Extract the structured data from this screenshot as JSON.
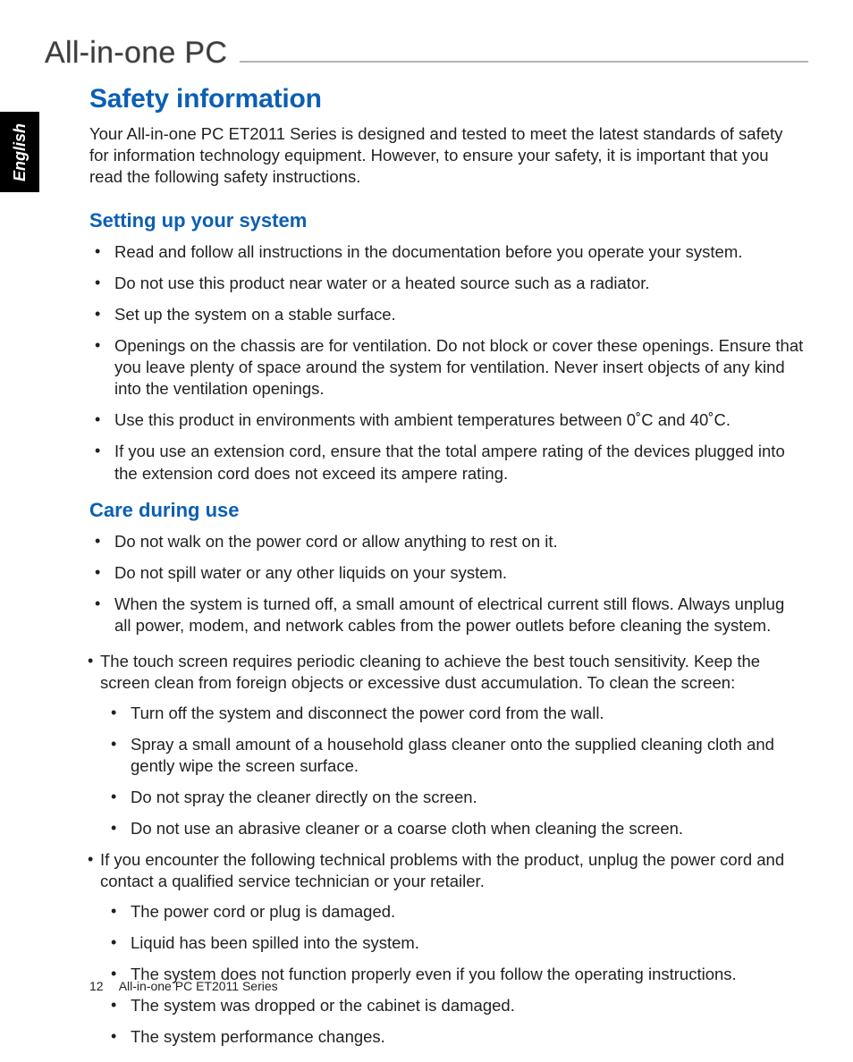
{
  "header": {
    "label": "All-in-one PC"
  },
  "sideTab": {
    "language": "English"
  },
  "title": "Safety information",
  "intro": "Your All-in-one PC ET2011 Series is designed and tested to meet the latest standards of safety for information technology equipment. However, to ensure your safety, it is important that you read the following safety instructions.",
  "sections": {
    "setup": {
      "heading": "Setting up your system",
      "items": [
        "Read and follow all instructions in the documentation before you operate your system.",
        "Do not use this product near water or a heated source such as a radiator.",
        "Set up the system on a stable surface.",
        "Openings on the chassis are for ventilation. Do not block or cover these openings. Ensure that you leave plenty of space around the system for ventilation. Never insert objects of any kind into the ventilation openings.",
        "Use this product in environments with ambient temperatures between 0˚C and 40˚C.",
        "If you use an extension cord, ensure that the total ampere rating of the devices plugged into the extension cord does not exceed its ampere rating."
      ]
    },
    "care": {
      "heading": "Care during use",
      "items1": [
        "Do not walk on the power cord or allow anything to rest on it.",
        "Do not spill water or any other liquids on your system.",
        "When the system is turned off, a small amount of electrical current still flows. Always unplug all power, modem, and network cables from the power outlets before cleaning the system."
      ],
      "item_ts_lead": "The touch screen requires periodic cleaning to achieve the best touch sensitivity. Keep the screen clean from foreign objects or excessive dust accumulation. To clean the screen:",
      "item_ts_sub": [
        "Turn off the system and disconnect the power cord from the wall.",
        "Spray a small amount of a household glass cleaner onto the supplied cleaning cloth and gently wipe the screen surface.",
        "Do not spray the cleaner directly on the screen.",
        "Do not use an abrasive cleaner or a coarse cloth when cleaning the screen."
      ],
      "item_tp_lead": "If you encounter the following technical problems with the product, unplug the power cord and contact a qualified service technician or your retailer.",
      "item_tp_sub": [
        "The power cord or plug is damaged.",
        "Liquid has been spilled into the system.",
        "The system does not function properly even if you follow the operating instructions.",
        "The system was dropped or the cabinet is damaged.",
        "The system performance changes."
      ]
    }
  },
  "footer": {
    "pageNumber": "12",
    "bookTitle": "All-in-one PC ET2011 Series"
  }
}
